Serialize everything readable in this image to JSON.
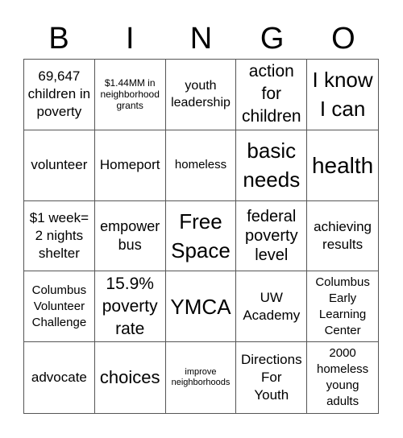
{
  "header": {
    "letters": [
      "B",
      "I",
      "N",
      "G",
      "O"
    ]
  },
  "cells": [
    "69,647\nchildren in\npoverty",
    "$1.44MM in\nneighborhood\ngrants",
    "youth\nleadership",
    "action\nfor\nchildren",
    "I know\nI can",
    "volunteer",
    "Homeport",
    "homeless",
    "basic\nneeds",
    "health",
    "$1 week=\n2 nights\nshelter",
    "empower\nbus",
    "Free\nSpace",
    "federal\npoverty\nlevel",
    "achieving\nresults",
    "Columbus\nVolunteer\nChallenge",
    "15.9%\npoverty\nrate",
    "YMCA",
    "UW\nAcademy",
    "Columbus\nEarly\nLearning\nCenter",
    "advocate",
    "choices",
    "improve\nneighborhoods",
    "Directions\nFor\nYouth",
    "2000\nhomeless\nyoung\nadults"
  ]
}
